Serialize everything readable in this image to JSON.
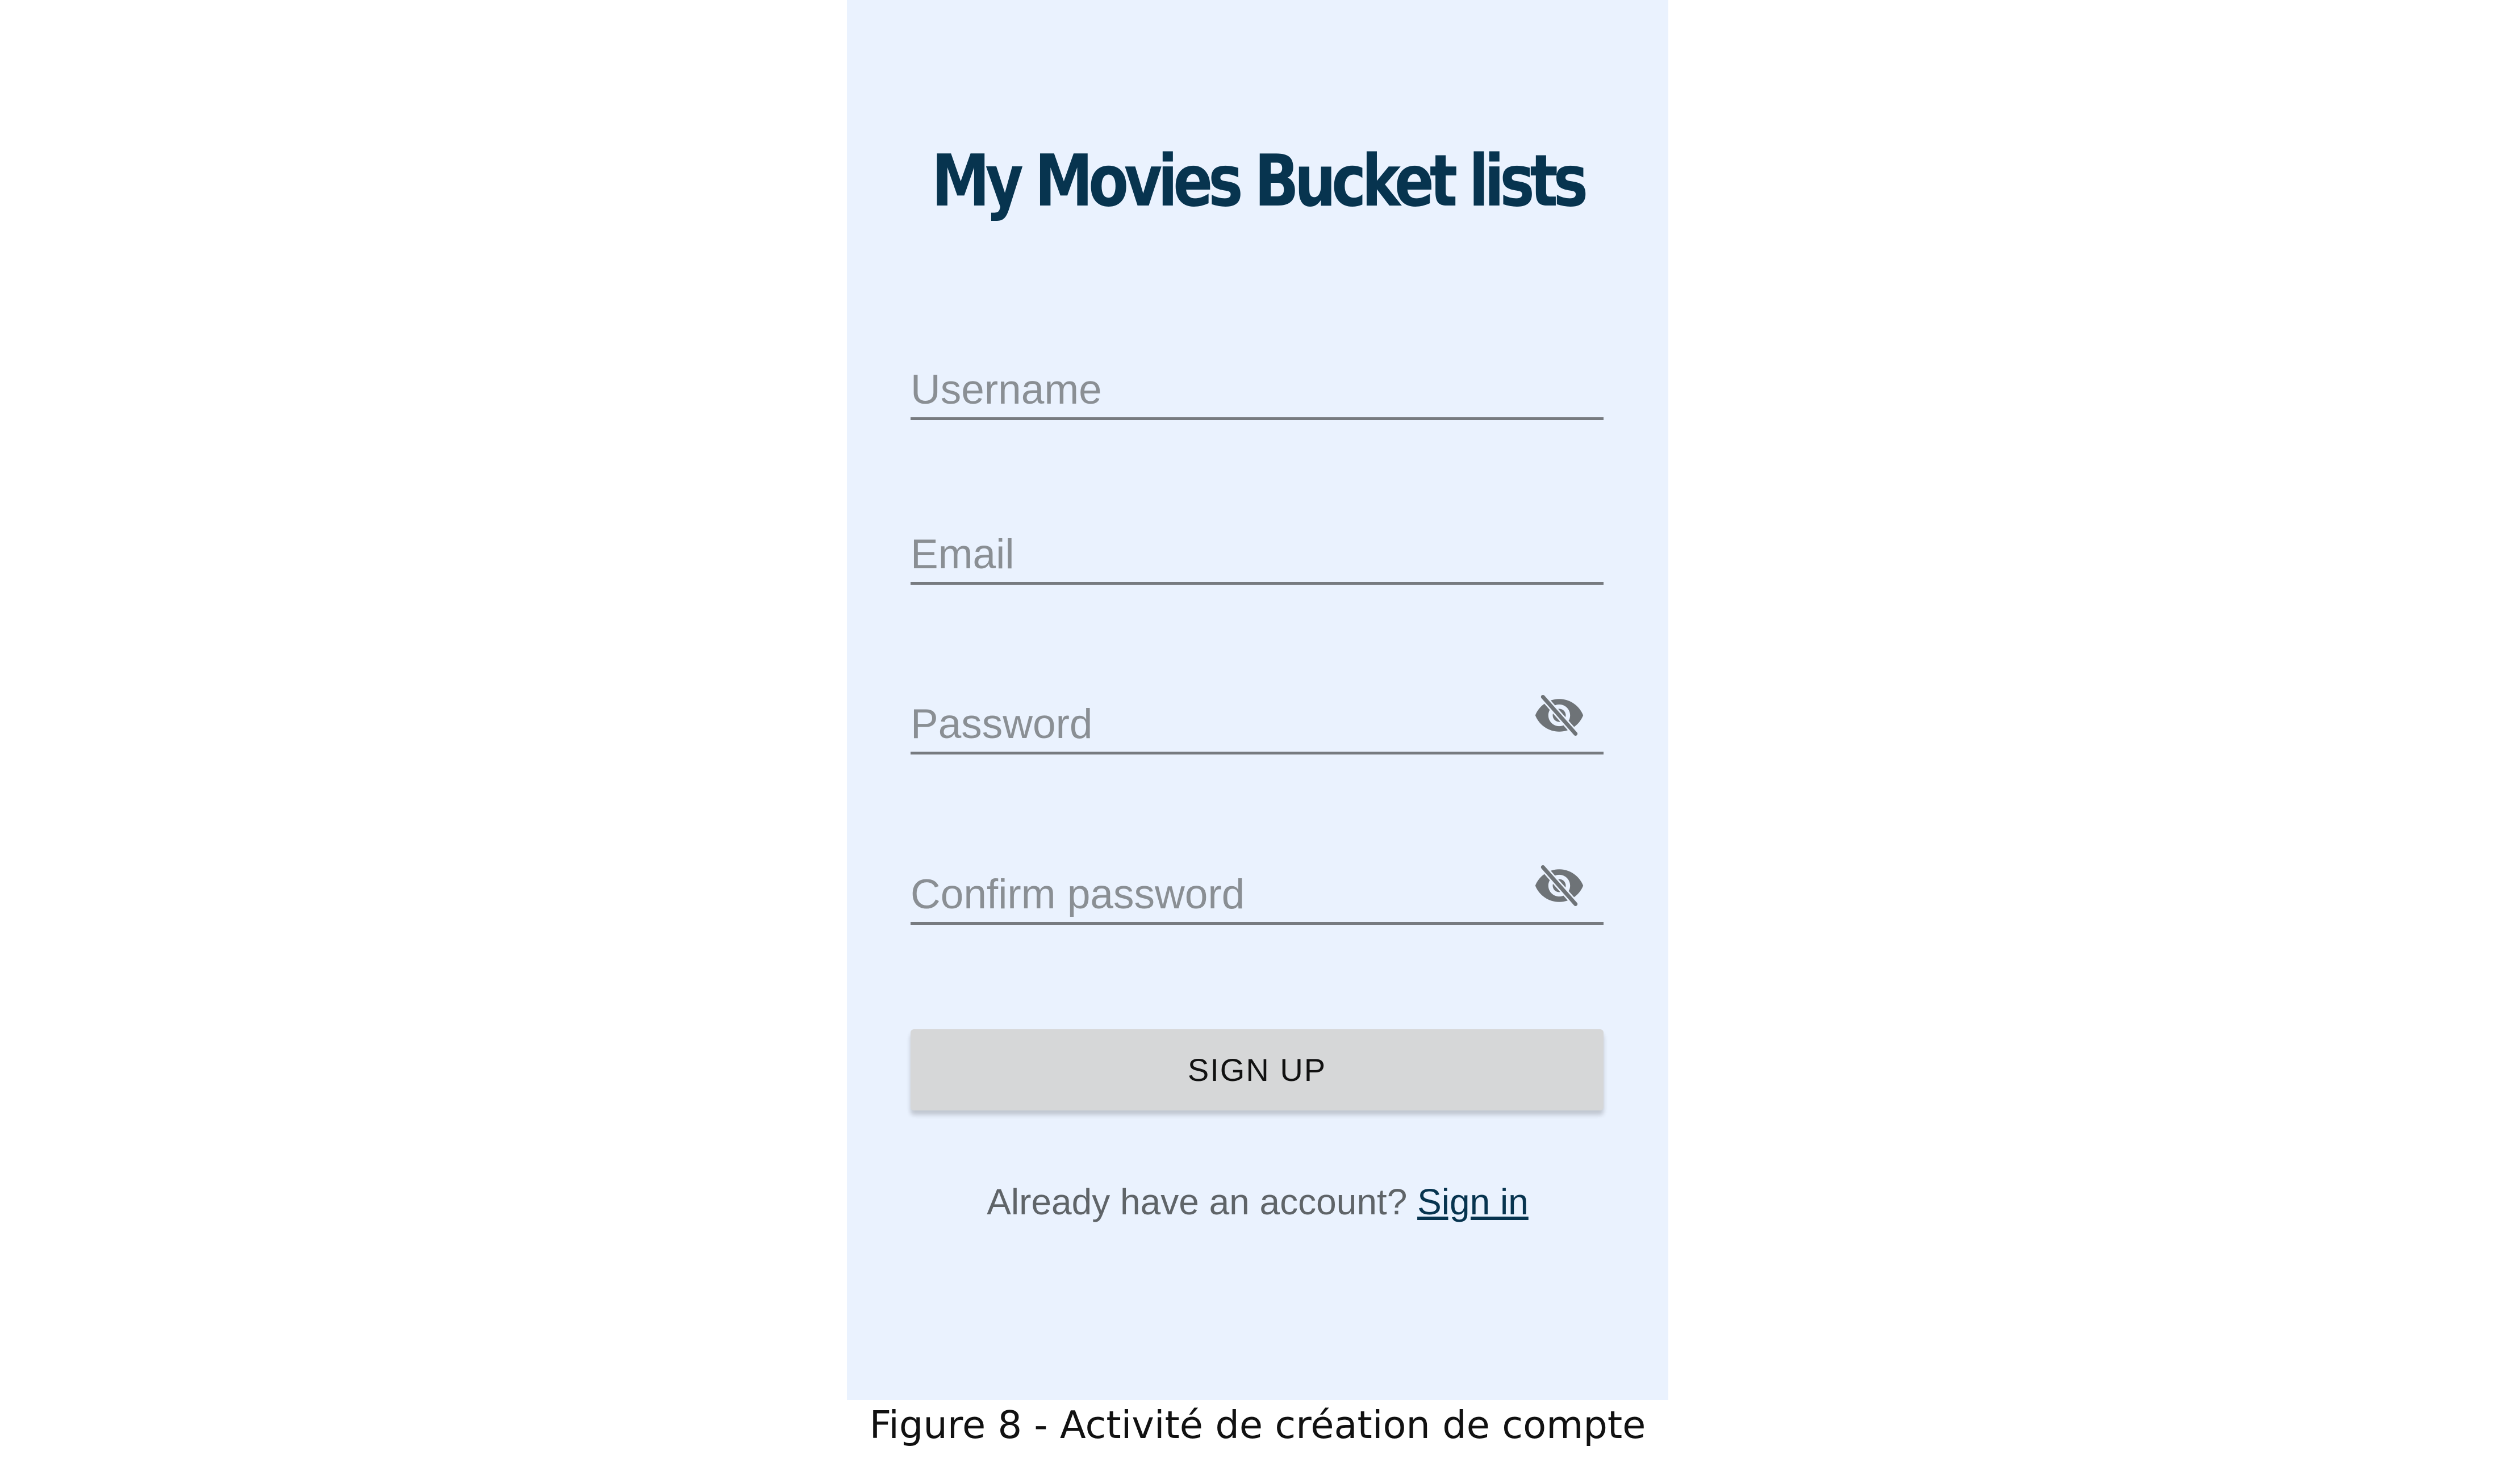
{
  "app": {
    "title": "My Movies Bucket lists"
  },
  "form": {
    "username_placeholder": "Username",
    "email_placeholder": "Email",
    "password_placeholder": "Password",
    "confirm_password_placeholder": "Confirm password",
    "password_toggle_icon": "eye-off-icon",
    "signup_label": "SIGN UP"
  },
  "footer": {
    "prompt": "Already have an account?",
    "signin_label": "Sign in"
  },
  "caption": "Figure 8 - Activité de création de compte",
  "colors": {
    "background": "#eaf2fe",
    "title": "#07344f",
    "link": "#07344f",
    "button": "#d6d7d8"
  }
}
